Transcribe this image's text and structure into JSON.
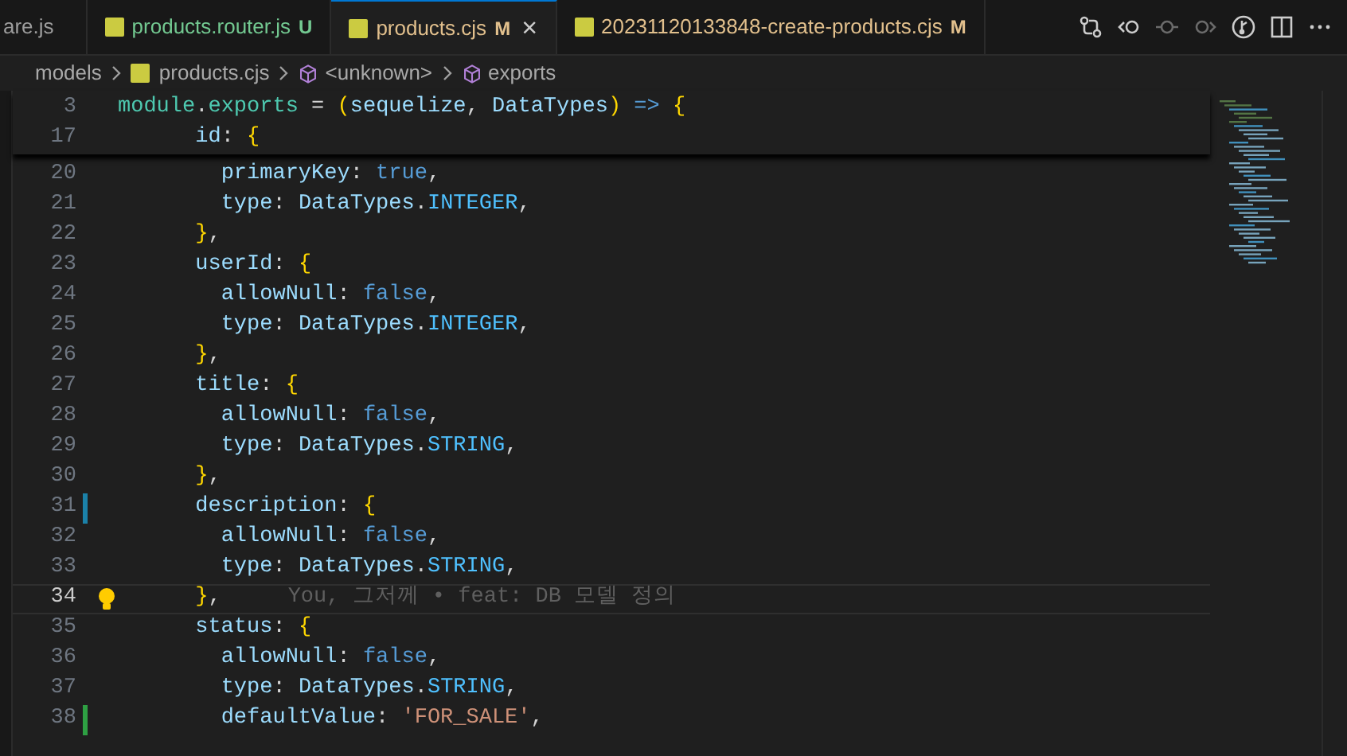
{
  "tabs": [
    {
      "label": "are.js",
      "kind": "plain",
      "selected": false
    },
    {
      "label": "products.router.js",
      "kind": "untracked",
      "badge": "U",
      "selected": false
    },
    {
      "label": "products.cjs",
      "kind": "modified",
      "badge": "M",
      "selected": true,
      "closable": true,
      "close_glyph": "×"
    },
    {
      "label": "20231120133848-create-products.cjs",
      "kind": "modified",
      "badge": "M",
      "selected": false
    }
  ],
  "toolbar": [
    {
      "kind": "compare",
      "disabled": false
    },
    {
      "kind": "back",
      "disabled": false
    },
    {
      "kind": "dot",
      "disabled": true
    },
    {
      "kind": "forward",
      "disabled": true
    },
    {
      "kind": "branch",
      "disabled": false
    },
    {
      "kind": "split",
      "disabled": false
    },
    {
      "kind": "more",
      "disabled": false
    }
  ],
  "breadcrumb": [
    {
      "label": "models",
      "kind": "folder"
    },
    {
      "label": "products.cjs",
      "kind": "file"
    },
    {
      "label": "<unknown>",
      "kind": "symbol"
    },
    {
      "label": "exports",
      "kind": "symbol"
    }
  ],
  "sticky_lines": [
    {
      "number": "3",
      "tokens": [
        {
          "text": "module",
          "kind": "module"
        },
        {
          "text": ".",
          "kind": "punct"
        },
        {
          "text": "exports",
          "kind": "module"
        },
        {
          "text": " = ",
          "kind": "punct"
        },
        {
          "text": "(",
          "kind": "brace"
        },
        {
          "text": "sequelize",
          "kind": "param"
        },
        {
          "text": ", ",
          "kind": "punct"
        },
        {
          "text": "DataTypes",
          "kind": "param"
        },
        {
          "text": ")",
          "kind": "brace"
        },
        {
          "text": " => ",
          "kind": "keyword"
        },
        {
          "text": "{",
          "kind": "brace"
        }
      ]
    },
    {
      "number": "17",
      "tokens": [
        {
          "text": "      id",
          "kind": "property"
        },
        {
          "text": ": ",
          "kind": "punct"
        },
        {
          "text": "{",
          "kind": "brace"
        }
      ]
    }
  ],
  "lines": [
    {
      "number": "20",
      "kind": "plain",
      "current": false,
      "tokens": [
        {
          "text": "        primaryKey",
          "kind": "property"
        },
        {
          "text": ": ",
          "kind": "punct"
        },
        {
          "text": "true",
          "kind": "keyword"
        },
        {
          "text": ",",
          "kind": "punct"
        }
      ]
    },
    {
      "number": "21",
      "kind": "plain",
      "current": false,
      "tokens": [
        {
          "text": "        type",
          "kind": "property"
        },
        {
          "text": ": ",
          "kind": "punct"
        },
        {
          "text": "DataTypes",
          "kind": "param"
        },
        {
          "text": ".",
          "kind": "punct"
        },
        {
          "text": "INTEGER",
          "kind": "constant"
        },
        {
          "text": ",",
          "kind": "punct"
        }
      ]
    },
    {
      "number": "22",
      "kind": "plain",
      "current": false,
      "tokens": [
        {
          "text": "      }",
          "kind": "brace"
        },
        {
          "text": ",",
          "kind": "punct"
        }
      ]
    },
    {
      "number": "23",
      "kind": "plain",
      "current": false,
      "tokens": [
        {
          "text": "      userId",
          "kind": "property"
        },
        {
          "text": ": ",
          "kind": "punct"
        },
        {
          "text": "{",
          "kind": "brace"
        }
      ]
    },
    {
      "number": "24",
      "kind": "plain",
      "current": false,
      "tokens": [
        {
          "text": "        allowNull",
          "kind": "property"
        },
        {
          "text": ": ",
          "kind": "punct"
        },
        {
          "text": "false",
          "kind": "keyword"
        },
        {
          "text": ",",
          "kind": "punct"
        }
      ]
    },
    {
      "number": "25",
      "kind": "plain",
      "current": false,
      "tokens": [
        {
          "text": "        type",
          "kind": "property"
        },
        {
          "text": ": ",
          "kind": "punct"
        },
        {
          "text": "DataTypes",
          "kind": "param"
        },
        {
          "text": ".",
          "kind": "punct"
        },
        {
          "text": "INTEGER",
          "kind": "constant"
        },
        {
          "text": ",",
          "kind": "punct"
        }
      ]
    },
    {
      "number": "26",
      "kind": "plain",
      "current": false,
      "tokens": [
        {
          "text": "      }",
          "kind": "brace"
        },
        {
          "text": ",",
          "kind": "punct"
        }
      ]
    },
    {
      "number": "27",
      "kind": "plain",
      "current": false,
      "tokens": [
        {
          "text": "      title",
          "kind": "property"
        },
        {
          "text": ": ",
          "kind": "punct"
        },
        {
          "text": "{",
          "kind": "brace"
        }
      ]
    },
    {
      "number": "28",
      "kind": "plain",
      "current": false,
      "tokens": [
        {
          "text": "        allowNull",
          "kind": "property"
        },
        {
          "text": ": ",
          "kind": "punct"
        },
        {
          "text": "false",
          "kind": "keyword"
        },
        {
          "text": ",",
          "kind": "punct"
        }
      ]
    },
    {
      "number": "29",
      "kind": "plain",
      "current": false,
      "tokens": [
        {
          "text": "        type",
          "kind": "property"
        },
        {
          "text": ": ",
          "kind": "punct"
        },
        {
          "text": "DataTypes",
          "kind": "param"
        },
        {
          "text": ".",
          "kind": "punct"
        },
        {
          "text": "STRING",
          "kind": "constant"
        },
        {
          "text": ",",
          "kind": "punct"
        }
      ]
    },
    {
      "number": "30",
      "kind": "plain",
      "current": false,
      "tokens": [
        {
          "text": "      }",
          "kind": "brace"
        },
        {
          "text": ",",
          "kind": "punct"
        }
      ]
    },
    {
      "number": "31",
      "kind": "modified",
      "current": false,
      "tokens": [
        {
          "text": "      description",
          "kind": "property"
        },
        {
          "text": ": ",
          "kind": "punct"
        },
        {
          "text": "{",
          "kind": "brace"
        }
      ]
    },
    {
      "number": "32",
      "kind": "plain",
      "current": false,
      "tokens": [
        {
          "text": "        allowNull",
          "kind": "property"
        },
        {
          "text": ": ",
          "kind": "punct"
        },
        {
          "text": "false",
          "kind": "keyword"
        },
        {
          "text": ",",
          "kind": "punct"
        }
      ]
    },
    {
      "number": "33",
      "kind": "plain",
      "current": false,
      "tokens": [
        {
          "text": "        type",
          "kind": "property"
        },
        {
          "text": ": ",
          "kind": "punct"
        },
        {
          "text": "DataTypes",
          "kind": "param"
        },
        {
          "text": ".",
          "kind": "punct"
        },
        {
          "text": "STRING",
          "kind": "constant"
        },
        {
          "text": ",",
          "kind": "punct"
        }
      ]
    },
    {
      "number": "34",
      "kind": "plain",
      "current": true,
      "lightbulb": true,
      "blame": "You, 그저께 • feat: DB 모델 정의",
      "tokens": [
        {
          "text": "      }",
          "kind": "brace"
        },
        {
          "text": ",",
          "kind": "punct"
        }
      ]
    },
    {
      "number": "35",
      "kind": "plain",
      "current": false,
      "tokens": [
        {
          "text": "      status",
          "kind": "property"
        },
        {
          "text": ": ",
          "kind": "punct"
        },
        {
          "text": "{",
          "kind": "brace"
        }
      ]
    },
    {
      "number": "36",
      "kind": "plain",
      "current": false,
      "tokens": [
        {
          "text": "        allowNull",
          "kind": "property"
        },
        {
          "text": ": ",
          "kind": "punct"
        },
        {
          "text": "false",
          "kind": "keyword"
        },
        {
          "text": ",",
          "kind": "punct"
        }
      ]
    },
    {
      "number": "37",
      "kind": "plain",
      "current": false,
      "tokens": [
        {
          "text": "        type",
          "kind": "property"
        },
        {
          "text": ": ",
          "kind": "punct"
        },
        {
          "text": "DataTypes",
          "kind": "param"
        },
        {
          "text": ".",
          "kind": "punct"
        },
        {
          "text": "STRING",
          "kind": "constant"
        },
        {
          "text": ",",
          "kind": "punct"
        }
      ]
    },
    {
      "number": "38",
      "kind": "added",
      "current": false,
      "tokens": [
        {
          "text": "        defaultValue",
          "kind": "property"
        },
        {
          "text": ": ",
          "kind": "punct"
        },
        {
          "text": "'FOR_SALE'",
          "kind": "string"
        },
        {
          "text": ",",
          "kind": "punct"
        }
      ]
    }
  ]
}
